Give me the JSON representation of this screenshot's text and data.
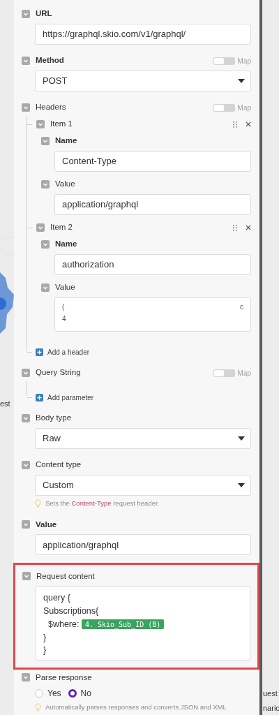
{
  "canvas": {
    "left_fragment": "est",
    "right_fragments": [
      "uest",
      "nario"
    ]
  },
  "fields": [
    {
      "kind": "input",
      "label": "URL",
      "bold": true,
      "expanded": true,
      "value": "https://graphql.skio.com/v1/graphql/"
    },
    {
      "kind": "select",
      "label": "Method",
      "bold": true,
      "expanded": true,
      "map": {
        "label": "Map",
        "on": false
      },
      "value": "POST"
    },
    {
      "kind": "array",
      "label": "Headers",
      "bold": false,
      "expanded": true,
      "map": {
        "label": "Map",
        "on": false
      },
      "items": [
        {
          "title": "Item 1",
          "expanded": true,
          "fields": [
            {
              "kind": "input",
              "label": "Name",
              "bold": true,
              "expanded": true,
              "value": "Content-Type"
            },
            {
              "kind": "input",
              "label": "Value",
              "bold": false,
              "expanded": true,
              "value": "application/graphql"
            }
          ]
        },
        {
          "title": "Item 2",
          "expanded": true,
          "fields": [
            {
              "kind": "input",
              "label": "Name",
              "bold": true,
              "expanded": true,
              "value": "authorization"
            },
            {
              "kind": "masked",
              "label": "Value",
              "bold": false,
              "expanded": true,
              "lines": [
                [
                  "(",
                  "c"
                ],
                [
                  "4"
                ]
              ]
            }
          ]
        }
      ],
      "add_label": "Add a header"
    },
    {
      "kind": "array",
      "label": "Query String",
      "bold": false,
      "expanded": true,
      "map": {
        "label": "Map",
        "on": false
      },
      "add_label": "Add parameter"
    },
    {
      "kind": "select",
      "label": "Body type",
      "bold": false,
      "expanded": true,
      "value": "Raw"
    },
    {
      "kind": "select",
      "label": "Content type",
      "bold": false,
      "expanded": true,
      "value": "Custom",
      "hint": {
        "before": "Sets the",
        "code": "Content-Type",
        "after": "request header."
      }
    },
    {
      "kind": "input",
      "label": "Value",
      "bold": true,
      "expanded": true,
      "value": "application/graphql"
    },
    {
      "kind": "code",
      "label": "Request content",
      "bold": false,
      "expanded": true,
      "highlighted": true,
      "lines": [
        [
          {
            "kind": "text",
            "text": "query {"
          }
        ],
        [
          {
            "kind": "text",
            "text": "Subscriptions{"
          }
        ],
        [
          {
            "kind": "text",
            "text": "  $where: "
          },
          {
            "kind": "pill",
            "text": "4. Skio_Sub_ID (B)"
          }
        ],
        [
          {
            "kind": "text",
            "text": "}"
          }
        ],
        [
          {
            "kind": "text",
            "text": "}"
          }
        ]
      ]
    },
    {
      "kind": "radio",
      "label": "Parse response",
      "bold": false,
      "expanded": true,
      "options": [
        {
          "label": "Yes",
          "selected": false
        },
        {
          "label": "No",
          "selected": true
        }
      ],
      "hint": {
        "before": "Automatically parses responses and converts JSON and XML"
      }
    }
  ]
}
